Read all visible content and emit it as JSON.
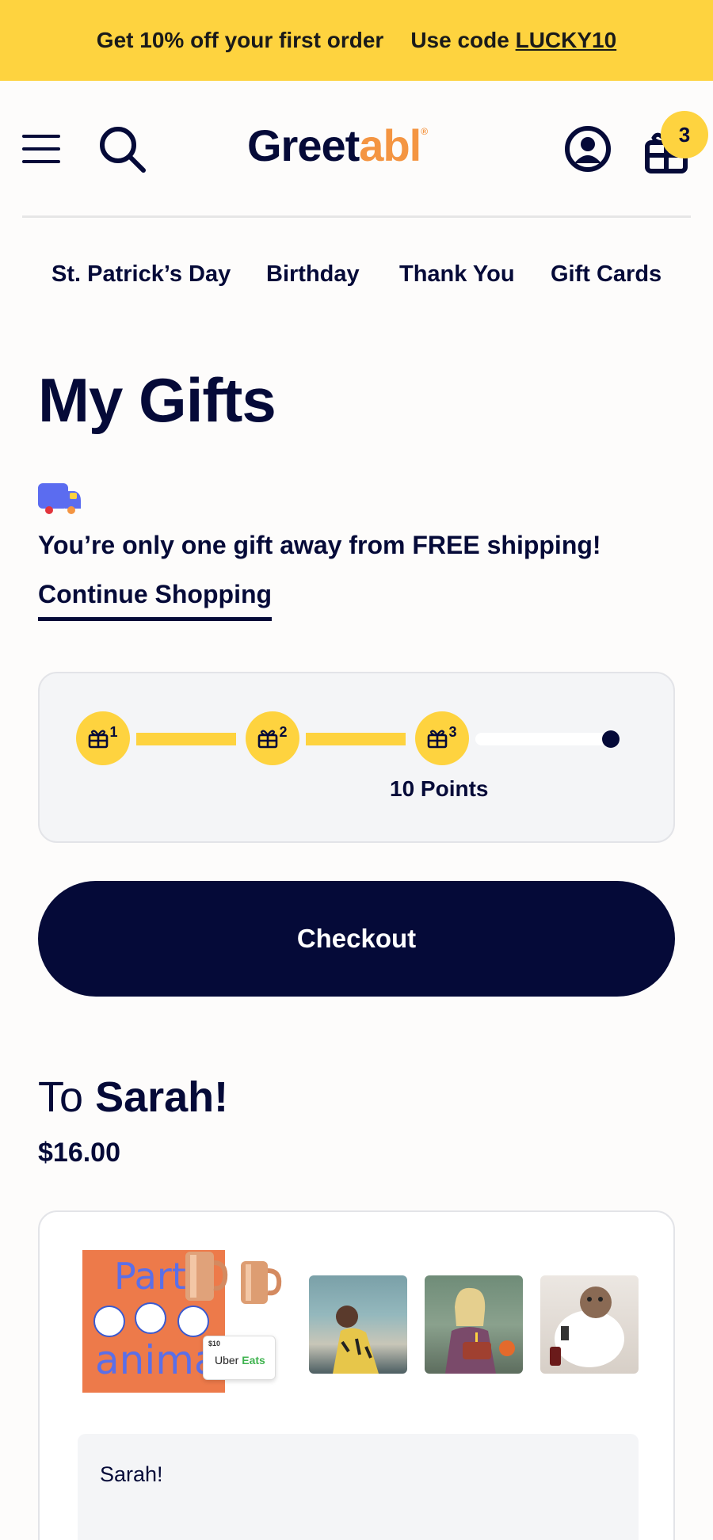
{
  "promo": {
    "offer": "Get 10% off your first order",
    "code_prefix": "Use code",
    "code": "LUCKY10"
  },
  "header": {
    "logo_main": "Greet",
    "logo_accent": "abl",
    "logo_mark": "®",
    "cart_count": "3",
    "icons": [
      "menu-icon",
      "search-icon",
      "account-icon",
      "gift-cart-icon"
    ]
  },
  "nav": {
    "items": [
      "St. Patrick’s Day",
      "Birthday",
      "Thank You",
      "Gift Cards"
    ]
  },
  "page": {
    "title": "My Gifts",
    "shipping_message": "You’re only one gift away from FREE shipping!",
    "continue_label": "Continue Shopping"
  },
  "progress": {
    "steps": [
      "1",
      "2",
      "3"
    ],
    "points_label": "10 Points",
    "completed_steps": 3,
    "total_stops": 4
  },
  "checkout_label": "Checkout",
  "gift": {
    "to_label": "To",
    "recipient": "Sarah!",
    "price": "$16.00",
    "card_text_top": "Party",
    "card_text_bottom": "animals",
    "giftcard_amount": "$10",
    "giftcard_brand_a": "Uber",
    "giftcard_brand_b": "Eats",
    "message": "Sarah!"
  },
  "colors": {
    "navy": "#050a38",
    "yellow": "#fed33f",
    "orange": "#f49542",
    "card_bg": "#f4f5f7"
  }
}
